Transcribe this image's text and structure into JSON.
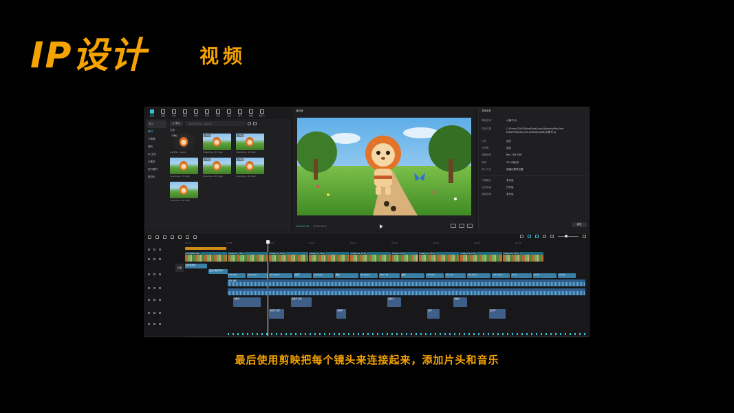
{
  "slide": {
    "title_main": "IP设计",
    "title_sub": "视频",
    "caption": "最后使用剪映把每个镜头来连接起来，添加片头和音乐"
  },
  "toolbar": {
    "items": [
      {
        "label": "媒体",
        "icon": "media-icon",
        "active": true
      },
      {
        "label": "音频",
        "icon": "audio-icon"
      },
      {
        "label": "文本",
        "icon": "text-icon"
      },
      {
        "label": "贴纸",
        "icon": "sticker-icon"
      },
      {
        "label": "特效",
        "icon": "effects-icon"
      },
      {
        "label": "转场",
        "icon": "transition-icon"
      },
      {
        "label": "字幕",
        "icon": "subtitle-icon"
      },
      {
        "label": "滤镜",
        "icon": "filter-icon"
      },
      {
        "label": "调节",
        "icon": "adjust-icon"
      },
      {
        "label": "模板",
        "icon": "template-icon"
      },
      {
        "label": "数字人",
        "icon": "avatar-icon"
      }
    ]
  },
  "media_sidebar": {
    "items": [
      "导入",
      "素材",
      "子草稿",
      "我的",
      "AI 生成",
      "云素材",
      "官方素材",
      "素材AI"
    ]
  },
  "media": {
    "import_label": "导入",
    "search_placeholder": "搜索文件名称、画面内容",
    "section_label": "全部",
    "items": [
      {
        "name": "cbd2f9..._a.png",
        "tag": "已添加"
      },
      {
        "name": "dreamina...87.mp4",
        "tag": "已添加"
      },
      {
        "name": "dreamina...40.mp4",
        "tag": "已添加"
      },
      {
        "name": "dreamina...74.mp4",
        "tag": ""
      },
      {
        "name": "dreamina...95.mp4",
        "tag": "已添加"
      },
      {
        "name": "dreamina...30.mp4",
        "tag": "已添加"
      },
      {
        "name": "dreamina...90.mp4",
        "tag": ""
      }
    ]
  },
  "player": {
    "title": "播放器",
    "timecode_current": "00:00:03:03",
    "timecode_total": "00:00:48:11"
  },
  "details": {
    "title": "草稿参数",
    "rows": [
      {
        "k": "草稿名称",
        "v": "小狮子(2)"
      },
      {
        "k": "保存位置",
        "v": "C:/Users/22605/AppData/Local/JianyingPro/User Data/Projects/com.lveditor.draft/小狮子(2)"
      },
      {
        "k": "比例",
        "v": "适应"
      },
      {
        "k": "分辨率",
        "v": "适应"
      },
      {
        "k": "草稿帧率",
        "v": "Rec.709 SDR"
      },
      {
        "k": "帧率",
        "v": "30.00帧/秒"
      },
      {
        "k": "导入方式",
        "v": "保留在原有位置"
      },
      {
        "k": "代理模式",
        "v": "未开启"
      },
      {
        "k": "自由层级",
        "v": "已开启"
      },
      {
        "k": "智能剪辑",
        "v": "未开启"
      }
    ],
    "export_label": "修改"
  },
  "timeline": {
    "ruler": [
      "00:00",
      "00:05",
      "00:10",
      "00:15",
      "00:20",
      "00:25",
      "00:30",
      "00:35",
      "00:40"
    ],
    "cover_label": "封面",
    "orange_clip": "",
    "video_clips": [
      "cbd2f9fa0a4e...",
      "dreamina_7532...",
      "dreamina_7532...",
      "dreamina_7532...",
      "dreamina_7532...",
      "00:00:10:26",
      "dreamina_7532...",
      "dreamina_7532...",
      "dreamina_7533..."
    ],
    "overlay_clips": [
      "百分百社科",
      "正在人物打印中..."
    ],
    "text_clips": [
      "The little",
      "feeling th...",
      "He walked ...",
      "又走了",
      "Suddenly",
      "他是",
      "He began",
      "Seller fly",
      "快去",
      "The litte...",
      "The lion...",
      "The fell a...",
      "and chord...",
      "Don't",
      "Brush",
      "seeing"
    ],
    "audio_label": "原声 音乐",
    "sfx_clips": [
      "音效声",
      "音乐声 音乐",
      "音效声 音乐",
      "音效声",
      "音效 声",
      "音乐",
      "音效声",
      "音乐声"
    ]
  },
  "colors": {
    "accent": "#f5a300",
    "ui_accent": "#39c2d7"
  }
}
